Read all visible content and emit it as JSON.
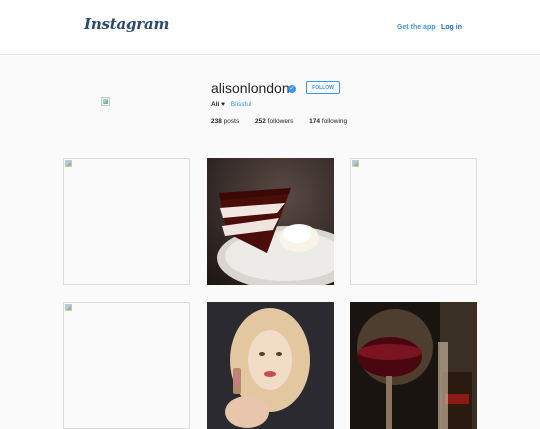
{
  "header": {
    "logo_text": "Instagram",
    "get_app_label": "Get the app",
    "login_label": "Log in"
  },
  "profile": {
    "username": "alisonlondon",
    "verified_icon": "verified-check-icon",
    "follow_label": "FOLLOW",
    "display_name": "Ali",
    "heart": "♥",
    "bio_link": "Blissful",
    "stats": {
      "posts_count": "238",
      "posts_label": "posts",
      "followers_count": "252",
      "followers_label": "followers",
      "following_count": "174",
      "following_label": "following"
    }
  },
  "colors": {
    "accent": "#3897f0",
    "background": "#fafafa",
    "text": "#262626"
  }
}
